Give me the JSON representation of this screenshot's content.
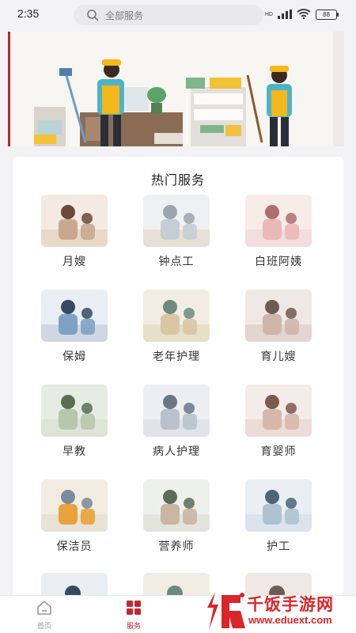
{
  "status_bar": {
    "time": "2:35",
    "signal_text": "HD",
    "battery": "88"
  },
  "search": {
    "placeholder": "全部服务"
  },
  "hot_services": {
    "title": "热门服务",
    "items": [
      {
        "label": "月嫂"
      },
      {
        "label": "钟点工"
      },
      {
        "label": "白班阿姨"
      },
      {
        "label": "保姆"
      },
      {
        "label": "老年护理"
      },
      {
        "label": "育儿嫂"
      },
      {
        "label": "早教"
      },
      {
        "label": "病人护理"
      },
      {
        "label": "育婴师"
      },
      {
        "label": "保洁员"
      },
      {
        "label": "营养师"
      },
      {
        "label": "护工"
      }
    ]
  },
  "nav": {
    "home": "首页",
    "service": "服务"
  },
  "watermark": {
    "title": "千饭手游网",
    "url": "www.eduext.com"
  },
  "colors": {
    "accent": "#c0282d",
    "background": "#f3f3f5"
  }
}
